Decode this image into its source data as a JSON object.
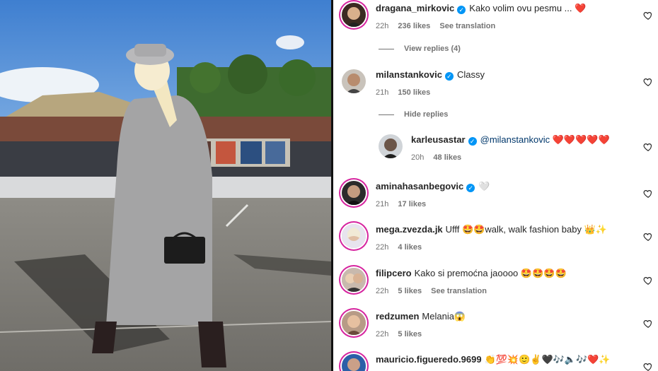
{
  "comments": [
    {
      "username": "dragana_mirkovic",
      "verified": true,
      "text": "Kako volim ovu pesmu ... ❤️",
      "time": "22h",
      "likes": "236 likes",
      "translate": "See translation"
    },
    {
      "username": "milanstankovic",
      "verified": true,
      "text": "Classy",
      "time": "21h",
      "likes": "150 likes"
    },
    {
      "username": "karleusastar",
      "verified": true,
      "mention": "@milanstankovic",
      "text": "❤️❤️❤️❤️❤️",
      "time": "20h",
      "likes": "48 likes"
    },
    {
      "username": "aminahasanbegovic",
      "verified": true,
      "text": "🤍",
      "time": "21h",
      "likes": "17 likes"
    },
    {
      "username": "mega.zvezda.jk",
      "verified": false,
      "text": "Ufff 🤩🤩walk, walk fashion baby 👑✨",
      "time": "22h",
      "likes": "4 likes"
    },
    {
      "username": "filipcero",
      "verified": false,
      "text": "Kako si premoćna jaoooo 🤩🤩🤩🤩",
      "time": "22h",
      "likes": "5 likes",
      "translate": "See translation"
    },
    {
      "username": "redzumen",
      "verified": false,
      "text": "Melania😱",
      "time": "22h",
      "likes": "5 likes"
    },
    {
      "username": "mauricio.figueredo.9699",
      "verified": false,
      "text": "👏💯💥🙂✌🖤🎶🔈🎶❤️✨"
    }
  ],
  "view_replies_label": "View replies (4)",
  "hide_replies_label": "Hide replies",
  "icons": {
    "like": "heart-outline-icon",
    "verified": "verified-badge-icon"
  },
  "colors": {
    "verified": "#0095f6",
    "username": "#262626",
    "meta": "#737373",
    "mention": "#00376b"
  }
}
